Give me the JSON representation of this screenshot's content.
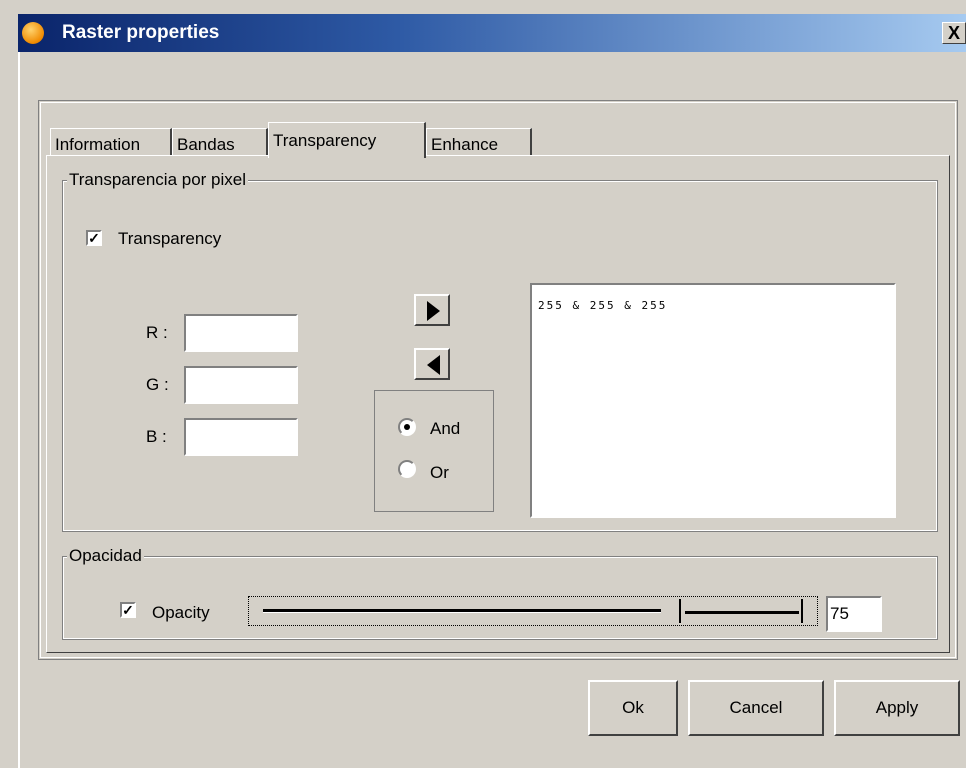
{
  "window": {
    "title": "Raster properties",
    "close_glyph": "X"
  },
  "tabs": [
    {
      "label": "Information"
    },
    {
      "label": "Bandas"
    },
    {
      "label": "Transparency",
      "active": true
    },
    {
      "label": "Enhance"
    }
  ],
  "pixel_group": {
    "title": "Transparencia por pixel",
    "transparency_label": "Transparency",
    "transparency_checked": true,
    "r_label": "R :",
    "g_label": "G :",
    "b_label": "B :",
    "r_value": "",
    "g_value": "",
    "b_value": "",
    "add_icon": "arrow-right-icon",
    "remove_icon": "arrow-left-icon",
    "and_label": "And",
    "or_label": "Or",
    "selected_operator": "And",
    "list_items": [
      "255 & 255 & 255"
    ]
  },
  "opacity_group": {
    "title": "Opacidad",
    "opacity_label": "Opacity",
    "opacity_checked": true,
    "value": "75"
  },
  "buttons": {
    "ok": "Ok",
    "cancel": "Cancel",
    "apply": "Apply"
  }
}
